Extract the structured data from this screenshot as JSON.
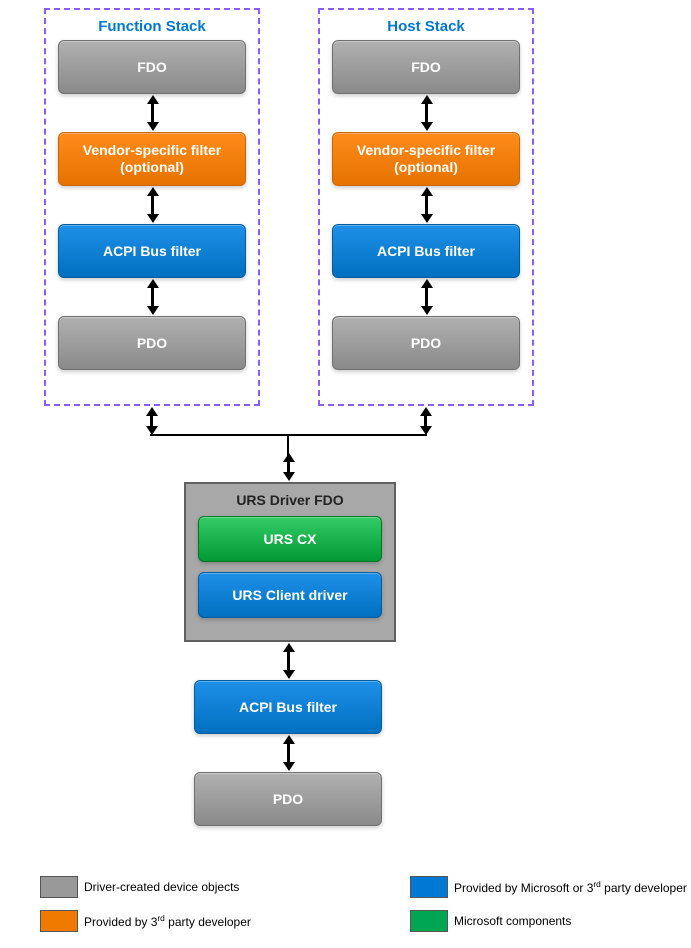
{
  "stacks": {
    "function": {
      "title": "Function Stack",
      "nodes": {
        "fdo": "FDO",
        "vendor": "Vendor-specific filter (optional)",
        "acpi": "ACPI Bus filter",
        "pdo": "PDO"
      }
    },
    "host": {
      "title": "Host Stack",
      "nodes": {
        "fdo": "FDO",
        "vendor": "Vendor-specific filter (optional)",
        "acpi": "ACPI Bus filter",
        "pdo": "PDO"
      }
    }
  },
  "urs": {
    "title": "URS Driver FDO",
    "cx": "URS CX",
    "client": "URS Client driver"
  },
  "lower": {
    "acpi": "ACPI Bus filter",
    "pdo": "PDO"
  },
  "legend": {
    "gray": "Driver-created device objects",
    "orange_prefix": "Provided by 3",
    "orange_suffix": " party developer",
    "blue_prefix": "Provided by Microsoft or 3",
    "blue_suffix": " party developer",
    "green": "Microsoft components"
  },
  "colors": {
    "gray": "#999999",
    "orange": "#F07A00",
    "blue": "#0078D4",
    "green": "#00A651"
  }
}
